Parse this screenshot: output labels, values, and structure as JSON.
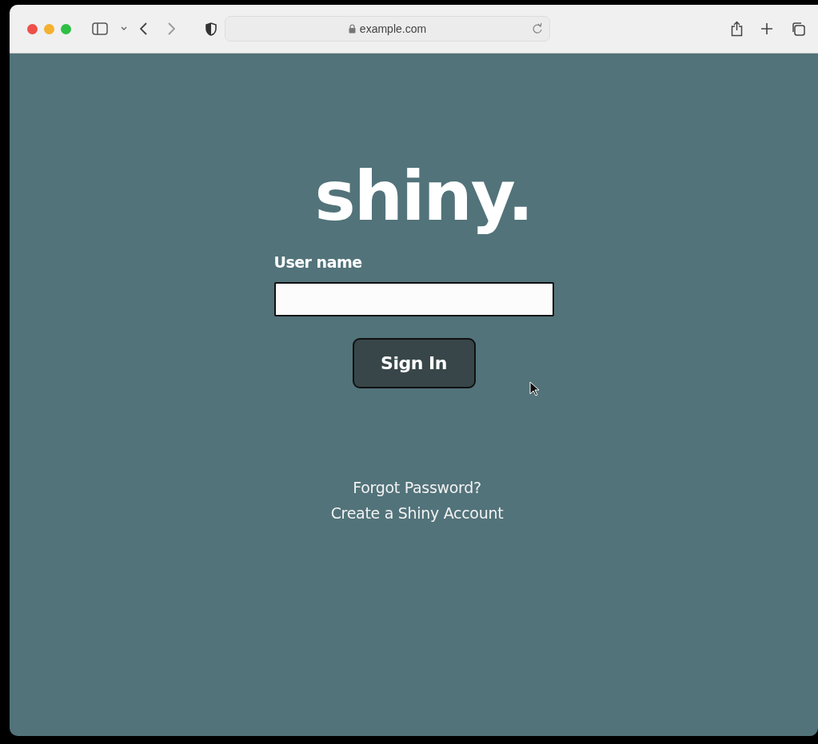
{
  "browser": {
    "address": "example.com"
  },
  "page": {
    "logo": "shiny.",
    "username_label": "User name",
    "sign_in_button": "Sign In",
    "links": [
      "Forgot Password?",
      "Create a Shiny Account"
    ]
  }
}
